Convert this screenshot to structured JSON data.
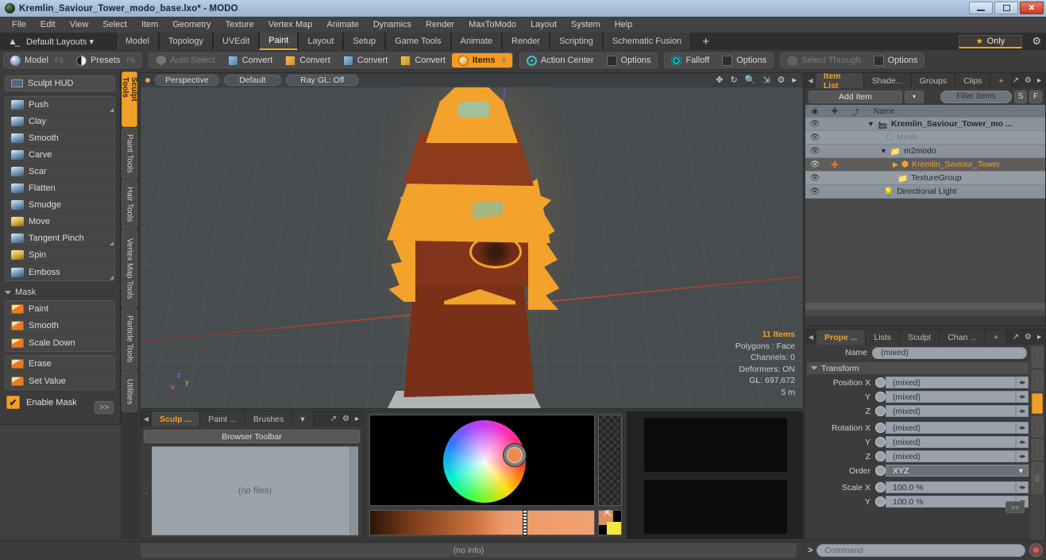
{
  "titlebar": {
    "title": "Kremlin_Saviour_Tower_modo_base.lxo* - MODO",
    "app_icon": "modo-sphere-icon",
    "minimize": "–",
    "maximize": "❐",
    "close": "✕"
  },
  "menu": {
    "items": [
      "File",
      "Edit",
      "View",
      "Select",
      "Item",
      "Geometry",
      "Texture",
      "Vertex Map",
      "Animate",
      "Dynamics",
      "Render",
      "MaxToModo",
      "Layout",
      "System",
      "Help"
    ]
  },
  "layoutbar": {
    "home_icon": "home-icon",
    "layouts_label": "Default Layouts ▾",
    "tabs": [
      {
        "label": "Model",
        "active": false
      },
      {
        "label": "Topology",
        "active": false
      },
      {
        "label": "UVEdit",
        "active": false
      },
      {
        "label": "Paint",
        "active": true
      },
      {
        "label": "Layout",
        "active": false
      },
      {
        "label": "Setup",
        "active": false
      },
      {
        "label": "Game Tools",
        "active": false
      },
      {
        "label": "Animate",
        "active": false
      },
      {
        "label": "Render",
        "active": false
      },
      {
        "label": "Scripting",
        "active": false
      },
      {
        "label": "Schematic Fusion",
        "active": false
      }
    ],
    "add_tab": "+",
    "only_label": "Only",
    "only_star": "★",
    "gear": "⚙"
  },
  "toolbar": {
    "mode_group": [
      {
        "label": "Model",
        "key": "F2",
        "icon": "sphere-icon",
        "state": "normal"
      },
      {
        "label": "Presets",
        "key": "F6",
        "icon": "half-sphere-icon",
        "state": "normal"
      }
    ],
    "action_group": [
      {
        "label": "Auto Select",
        "icon": "shield-icon",
        "state": "dim"
      },
      {
        "label": "Convert",
        "icon": "box-blue-icon",
        "state": "normal"
      },
      {
        "label": "Convert",
        "icon": "box-gold-icon",
        "state": "normal"
      },
      {
        "label": "Convert",
        "icon": "box-blue-icon",
        "state": "normal"
      },
      {
        "label": "Convert",
        "icon": "box-gold-icon",
        "state": "normal"
      },
      {
        "label": "Items",
        "icon": "ball-icon",
        "state": "on",
        "key": "5"
      }
    ],
    "center_group": [
      {
        "label": "Action Center",
        "icon": "target-icon",
        "state": "normal"
      },
      {
        "label": "Options",
        "icon": "checkbox-icon",
        "state": "normal"
      }
    ],
    "falloff_group": [
      {
        "label": "Falloff",
        "icon": "falloff-icon",
        "state": "normal"
      },
      {
        "label": "Options",
        "icon": "checkbox-icon",
        "state": "normal"
      }
    ],
    "through_group": [
      {
        "label": "Select Through",
        "icon": "select-through-icon",
        "state": "dim"
      },
      {
        "label": "Options",
        "icon": "checkbox-icon",
        "state": "normal"
      }
    ]
  },
  "left_panel": {
    "hud_label": "Sculpt HUD",
    "sculpt_tools": [
      {
        "label": "Push",
        "icon": "brush-blue-icon",
        "has_corner": true
      },
      {
        "label": "Clay",
        "icon": "brush-blue-icon",
        "has_corner": false
      },
      {
        "label": "Smooth",
        "icon": "brush-blue-icon",
        "has_corner": false
      },
      {
        "label": "Carve",
        "icon": "brush-blue-icon",
        "has_corner": false
      },
      {
        "label": "Scar",
        "icon": "brush-blue-icon",
        "has_corner": false
      },
      {
        "label": "Flatten",
        "icon": "brush-blue-icon",
        "has_corner": false
      },
      {
        "label": "Smudge",
        "icon": "brush-blue-icon",
        "has_corner": false
      },
      {
        "label": "Move",
        "icon": "brush-yellow-icon",
        "has_corner": false
      },
      {
        "label": "Tangent Pinch",
        "icon": "brush-blue-icon",
        "has_corner": true
      },
      {
        "label": "Spin",
        "icon": "brush-yellow-icon",
        "has_corner": false
      },
      {
        "label": "Emboss",
        "icon": "brush-blue-icon",
        "has_corner": true
      }
    ],
    "mask_section": "Mask",
    "mask_tools_a": [
      {
        "label": "Paint",
        "icon": "mask-orange-icon"
      },
      {
        "label": "Smooth",
        "icon": "mask-orange-icon"
      },
      {
        "label": "Scale Down",
        "icon": "mask-orange-icon"
      }
    ],
    "mask_tools_b": [
      {
        "label": "Erase",
        "icon": "mask-green-icon"
      },
      {
        "label": "Set Value",
        "icon": "mask-orange-icon"
      }
    ],
    "enable_mask": {
      "label": "Enable Mask",
      "checked": true,
      "check_glyph": "✔"
    },
    "more_button": ">>"
  },
  "vertical_tabs": [
    {
      "label": "Sculpt Tools",
      "active": true
    },
    {
      "label": "Paint Tools",
      "active": false
    },
    {
      "label": "Hair Tools",
      "active": false
    },
    {
      "label": "Vertex Map Tools",
      "active": false
    },
    {
      "label": "Particle Tools",
      "active": false
    },
    {
      "label": "Utilities",
      "active": false
    }
  ],
  "viewport": {
    "header": {
      "view_mode": "Perspective",
      "shading": "Default",
      "raygl": "Ray GL: Off",
      "icons": [
        "move-icon",
        "rotate-icon",
        "zoom-icon",
        "fit-icon",
        "gear-icon",
        "chevron-right-icon"
      ]
    },
    "info": {
      "items": "11 Items",
      "polygons": "Polygons : Face",
      "channels": "Channels: 0",
      "deformers": "Deformers: ON",
      "gl": "GL: 697,672",
      "scale": "5 m"
    },
    "gizmo": {
      "x": "x",
      "y": "y",
      "z": "z"
    },
    "model_name": "Kremlin Saviour Tower"
  },
  "item_list": {
    "tabs": [
      {
        "label": "Item List",
        "active": true
      },
      {
        "label": "Shade...",
        "active": false
      },
      {
        "label": "Groups",
        "active": false
      },
      {
        "label": "Clips",
        "active": false
      }
    ],
    "add_tab": "+",
    "panel_icons": [
      "expand-icon",
      "gear-icon",
      "chevron-right-icon"
    ],
    "add_item_label": "Add Item",
    "caret": "▾",
    "filter_placeholder": "Filter Items",
    "btn_s": "S",
    "btn_f": "F",
    "columns": {
      "eye": "◉",
      "plus": "✚",
      "mark": "⤴",
      "name": "Name"
    },
    "rows": [
      {
        "name": "Kremlin_Saviour_Tower_mo ...",
        "icon": "scene-icon",
        "indent": 1,
        "expanded": true,
        "dim": false,
        "selected": false,
        "plus": false
      },
      {
        "name": "Mesh",
        "icon": "mesh-icon",
        "indent": 2,
        "expanded": false,
        "dim": true,
        "selected": false,
        "plus": false
      },
      {
        "name": "m2modo",
        "icon": "folder-icon",
        "indent": 2,
        "expanded": true,
        "dim": false,
        "selected": false,
        "plus": false
      },
      {
        "name": "Kremlin_Saviour_Tower",
        "icon": "mesh-item-icon",
        "indent": 3,
        "expanded": false,
        "dim": false,
        "selected": true,
        "plus": true
      },
      {
        "name": "TextureGroup",
        "icon": "folder-icon",
        "indent": 3,
        "expanded": false,
        "dim": false,
        "selected": false,
        "plus": false
      },
      {
        "name": "Directional Light",
        "icon": "light-icon",
        "indent": 2,
        "expanded": false,
        "dim": false,
        "selected": false,
        "plus": false
      }
    ]
  },
  "properties": {
    "tabs": [
      {
        "label": "Prope ...",
        "active": true
      },
      {
        "label": "Lists",
        "active": false
      },
      {
        "label": "Sculpt",
        "active": false
      },
      {
        "label": "Chan ...",
        "active": false
      }
    ],
    "add_tab": "+",
    "name_label": "Name",
    "name_value": "(mixed)",
    "transform_section": "Transform",
    "fields": [
      {
        "label": "Position X",
        "value": "(mixed)",
        "type": "num"
      },
      {
        "label": "Y",
        "value": "(mixed)",
        "type": "num"
      },
      {
        "label": "Z",
        "value": "(mixed)",
        "type": "num"
      },
      {
        "label": "Rotation X",
        "value": "(mixed)",
        "type": "num"
      },
      {
        "label": "Y",
        "value": "(mixed)",
        "type": "num"
      },
      {
        "label": "Z",
        "value": "(mixed)",
        "type": "num"
      },
      {
        "label": "Order",
        "value": "XYZ",
        "type": "select"
      },
      {
        "label": "Scale X",
        "value": "100.0 %",
        "type": "num"
      },
      {
        "label": "Y",
        "value": "100.0 %",
        "type": "num"
      }
    ],
    "more_button": ">>",
    "gutter_label": "Us"
  },
  "browser": {
    "tabs": [
      {
        "label": "Sculp ...",
        "active": true
      },
      {
        "label": "Paint ...",
        "active": false
      },
      {
        "label": "Brushes",
        "active": false
      }
    ],
    "caret": "▾",
    "toolbar_label": "Browser Toolbar",
    "empty_text": "(no files)"
  },
  "color_picker": {
    "wheel": "color-wheel",
    "selected_color": "#ef8a4d",
    "new_color": "#f5e73a",
    "gradient_from": "#2a1509",
    "gradient_to": "#f0a072"
  },
  "statusbar": {
    "info": "(no info)",
    "command_prompt": ">",
    "command_placeholder": "Command",
    "record_icon": "record-icon"
  },
  "colors": {
    "accent": "#f0a02a",
    "panel_bg": "#3c3c3c",
    "viewport_bg": "#474c4f",
    "list_row": "#8a939b",
    "wire": "#f3a22c",
    "mesh_fill": "#7a2f18"
  }
}
